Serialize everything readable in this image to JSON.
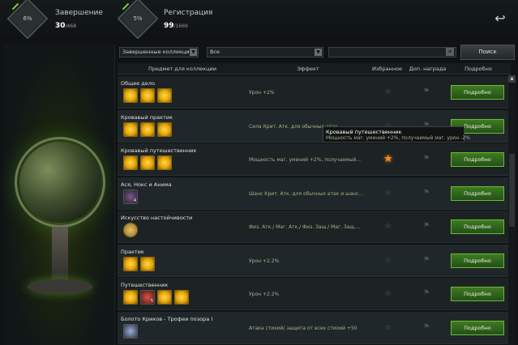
{
  "header": {
    "completion": {
      "title": "Завершение",
      "percent": "6%",
      "value": "30",
      "total": "/468"
    },
    "registration": {
      "title": "Регистрация",
      "percent": "5%",
      "value": "99",
      "total": "/1669"
    },
    "back_icon": "return-arrow-icon"
  },
  "filters": {
    "collection_filter": "Завершенные коллекции",
    "type_filter": "Все",
    "search_value": "",
    "search_button": "Поиск"
  },
  "table": {
    "columns": [
      "Предмет для коллекции",
      "Эффект",
      "Избранное",
      "Доп. награда",
      "Подробно"
    ],
    "detail_label": "Подробно",
    "rows": [
      {
        "name": "Общее дело",
        "effect": "Урон +2%",
        "favorite": false,
        "icons": [
          "gold",
          "gold",
          "gold"
        ]
      },
      {
        "name": "Кровавый практик",
        "effect": "Сила Крит. Атк. для обычных атак",
        "favorite": false,
        "icons": [
          "gold",
          "gold",
          "gold"
        ]
      },
      {
        "name": "Кровавый путешественник",
        "effect": "Мощность маг. умений +2%, получаемый...",
        "favorite": true,
        "icons": [
          "gold",
          "gold",
          "gold"
        ]
      },
      {
        "name": "Ася, Нокс и Анима",
        "effect": "Шанс Крит. Атк. для обычных атак и шанс...",
        "favorite": false,
        "icons": [
          "purple"
        ]
      },
      {
        "name": "Искусство настойчивости",
        "effect": "Физ. Атк./ Маг. Атк./ Физ. Защ./ Маг. Защ....",
        "favorite": false,
        "icons": [
          "coin"
        ]
      },
      {
        "name": "Практик",
        "effect": "Урон +2.2%",
        "favorite": false,
        "icons": [
          "gold",
          "gold"
        ]
      },
      {
        "name": "Путешественник",
        "effect": "Урон +2.2%",
        "favorite": false,
        "icons": [
          "gold",
          "red",
          "gold",
          "gold"
        ]
      },
      {
        "name": "Болото Криков - Трофеи позора I",
        "effect": "Атака стихий/ защита от всех стихий +50",
        "favorite": false,
        "icons": [
          "blue"
        ]
      }
    ]
  },
  "tooltip": {
    "title": "Кровавый путешественник",
    "text": "Мощность маг. умений +2%, получаемый маг. урон -2%"
  },
  "icon_counts": {
    "red": "5",
    "purple": "4"
  }
}
